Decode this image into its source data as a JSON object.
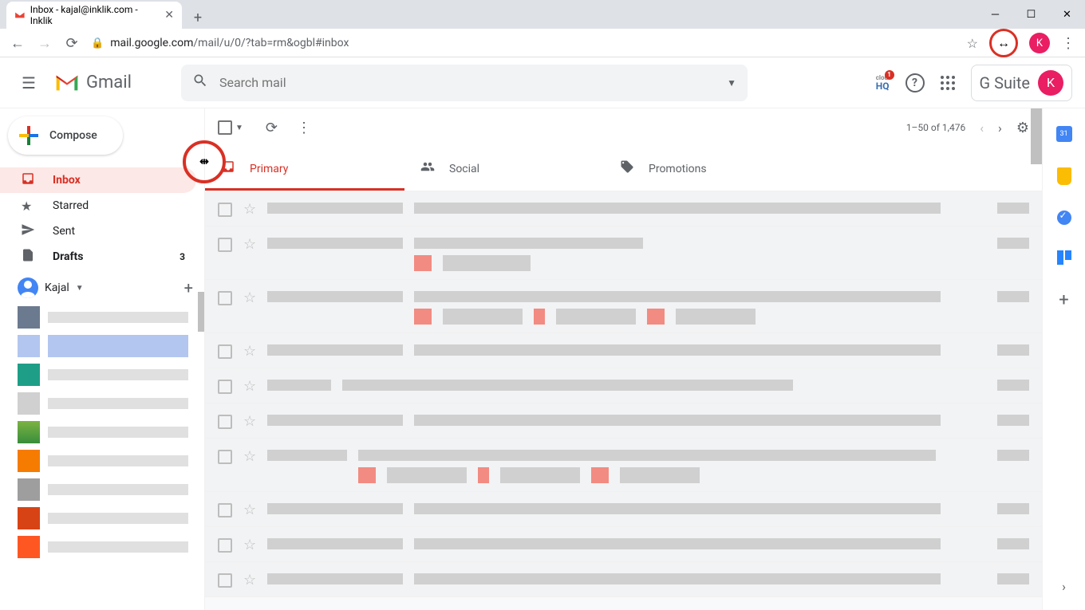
{
  "browser": {
    "tab_title": "Inbox - kajal@inklik.com - Inklik",
    "url_host": "mail.google.com",
    "url_path": "/mail/u/0/?tab=rm&ogbl#inbox",
    "profile_initial": "K"
  },
  "header": {
    "logo_text": "Gmail",
    "search_placeholder": "Search mail",
    "hq_badge": "1",
    "gsuite": "G Suite",
    "profile_initial": "K"
  },
  "sidebar": {
    "compose": "Compose",
    "nav": [
      {
        "icon": "inbox",
        "label": "Inbox",
        "active": true
      },
      {
        "icon": "star",
        "label": "Starred"
      },
      {
        "icon": "send",
        "label": "Sent"
      },
      {
        "icon": "draft",
        "label": "Drafts",
        "count": "3",
        "bold": true
      }
    ],
    "user_name": "Kajal"
  },
  "toolbar": {
    "page_info": "1–50 of 1,476"
  },
  "tabs": [
    {
      "icon": "inbox",
      "label": "Primary",
      "active": true
    },
    {
      "icon": "people",
      "label": "Social"
    },
    {
      "icon": "tag",
      "label": "Promotions"
    }
  ],
  "sidepanel": {
    "calendar_day": "31"
  }
}
